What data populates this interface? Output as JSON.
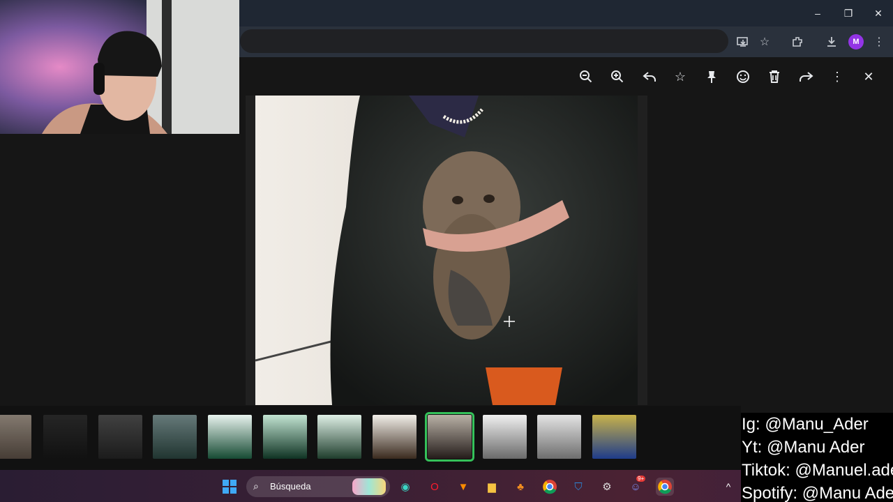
{
  "browser": {
    "window_controls": {
      "minimize": "–",
      "restore": "❐",
      "close": "✕"
    },
    "toolbar_icons": [
      "install-app-icon",
      "bookmark-star-icon",
      "extensions-icon",
      "download-icon",
      "profile-avatar",
      "menu-icon"
    ],
    "profile_initial": "M"
  },
  "viewer": {
    "toolbar": [
      "zoom-out-icon",
      "zoom-in-icon",
      "reply-icon",
      "star-icon",
      "pin-icon",
      "react-icon",
      "delete-icon",
      "forward-icon",
      "more-icon",
      "close-icon"
    ],
    "photo_alt": "person holding dachshund"
  },
  "filmstrip": {
    "thumbnail_count": 12,
    "selected_index": 8
  },
  "taskbar": {
    "search_placeholder": "Búsqueda",
    "apps": [
      "start-icon",
      "edge-icon",
      "opera-icon",
      "brave-icon",
      "file-explorer-icon",
      "fl-studio-icon",
      "chrome-icon",
      "defender-icon",
      "steam-icon",
      "discord-icon",
      "chrome-profile-icon"
    ],
    "discord_badge": "9+",
    "tray_chevron": "^"
  },
  "overlay": {
    "lines": [
      "Ig: @Manu_Ader",
      "Yt: @Manu Ader",
      "Tiktok: @Manuel.ader",
      "Spotify: @Manu Ader"
    ]
  },
  "colors": {
    "selected_outline": "#35c15a",
    "profile_avatar": "#9334e6"
  }
}
